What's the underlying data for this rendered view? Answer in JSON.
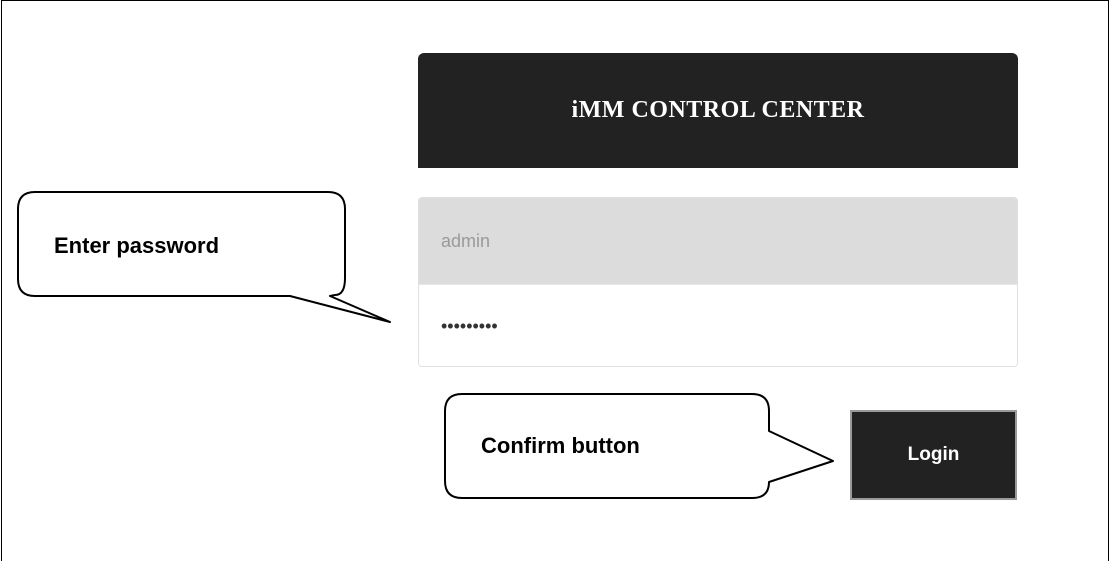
{
  "header": {
    "title": "iMM CONTROL CENTER"
  },
  "login_form": {
    "username_value": "admin",
    "password_value": "password1",
    "login_label": "Login"
  },
  "annotations": {
    "password_callout": "Enter password",
    "button_callout": "Confirm button"
  },
  "colors": {
    "header_bg": "#222222",
    "username_bg": "#dcdcdc",
    "button_bg": "#222222"
  }
}
